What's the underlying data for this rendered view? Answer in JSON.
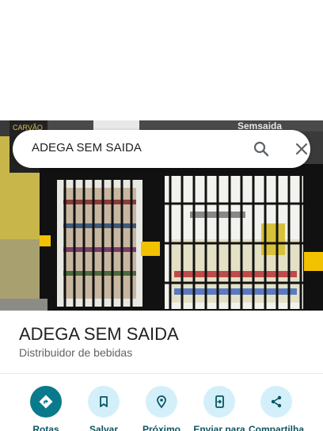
{
  "search": {
    "query": "ADEGA SEM SAIDA"
  },
  "photo": {
    "sign_left": "CARVÃO",
    "sign_right": "Semsaida"
  },
  "place": {
    "name": "ADEGA SEM SAIDA",
    "category": "Distribuidor de bebidas"
  },
  "actions": [
    {
      "label": "Rotas",
      "icon": "directions-icon"
    },
    {
      "label": "Salvar",
      "icon": "bookmark-icon"
    },
    {
      "label": "Próximo",
      "icon": "nearby-icon"
    },
    {
      "label": "Enviar para",
      "icon": "send-to-phone-icon"
    },
    {
      "label": "Compartilha",
      "icon": "share-icon"
    }
  ],
  "colors": {
    "accent": "#097a8c",
    "action_bg": "#d3f0fa",
    "action_text": "#0b5563"
  }
}
